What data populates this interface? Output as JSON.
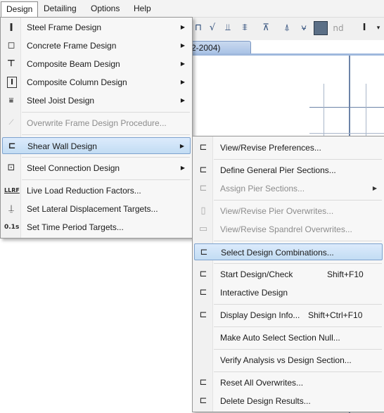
{
  "menubar": {
    "items": [
      "Design",
      "Detailing",
      "Options",
      "Help"
    ]
  },
  "toolbar": {
    "doc_tab": "2-2004)",
    "nd_label": "nd"
  },
  "design_menu": {
    "items": [
      {
        "label": "Steel Frame Design",
        "icon": "steel-frame-icon",
        "submenu": true,
        "enabled": true
      },
      {
        "label": "Concrete Frame Design",
        "icon": "concrete-frame-icon",
        "submenu": true,
        "enabled": true
      },
      {
        "label": "Composite Beam Design",
        "icon": "composite-beam-icon",
        "submenu": true,
        "enabled": true
      },
      {
        "label": "Composite Column Design",
        "icon": "composite-column-icon",
        "submenu": true,
        "enabled": true
      },
      {
        "label": "Steel Joist Design",
        "icon": "steel-joist-icon",
        "submenu": true,
        "enabled": true
      },
      {
        "label": "Overwrite Frame Design Procedure...",
        "icon": "overwrite-procedure-icon",
        "submenu": false,
        "enabled": false
      },
      {
        "label": "Shear Wall Design",
        "icon": "shear-wall-icon",
        "submenu": true,
        "enabled": true,
        "highlighted": true
      },
      {
        "label": "Steel Connection Design",
        "icon": "steel-connection-icon",
        "submenu": true,
        "enabled": true
      },
      {
        "label": "Live Load Reduction Factors...",
        "icon": "llrf-icon",
        "icon_text": "LLRF",
        "submenu": false,
        "enabled": true
      },
      {
        "label": "Set Lateral Displacement Targets...",
        "icon": "displacement-target-icon",
        "submenu": false,
        "enabled": true
      },
      {
        "label": "Set Time Period Targets...",
        "icon": "time-period-icon",
        "icon_text": "0.1s",
        "submenu": false,
        "enabled": true
      }
    ]
  },
  "shear_wall_menu": {
    "items": [
      {
        "label": "View/Revise Preferences...",
        "shortcut": "",
        "icon": "preferences-icon",
        "enabled": true
      },
      {
        "label": "Define General Pier Sections...",
        "shortcut": "",
        "icon": "define-pier-icon",
        "enabled": true
      },
      {
        "label": "Assign Pier Sections...",
        "shortcut": "",
        "icon": "assign-pier-icon",
        "enabled": false,
        "submenu": true
      },
      {
        "label": "View/Revise Pier Overwrites...",
        "shortcut": "",
        "icon": "pier-overwrites-icon",
        "enabled": false
      },
      {
        "label": "View/Revise Spandrel Overwrites...",
        "shortcut": "",
        "icon": "spandrel-overwrites-icon",
        "enabled": false
      },
      {
        "label": "Select Design Combinations...",
        "shortcut": "",
        "icon": "design-combinations-icon",
        "enabled": true,
        "highlighted": true
      },
      {
        "label": "Start Design/Check",
        "shortcut": "Shift+F10",
        "icon": "start-design-icon",
        "enabled": true
      },
      {
        "label": "Interactive Design",
        "shortcut": "",
        "icon": "interactive-design-icon",
        "enabled": true
      },
      {
        "label": "Display Design Info...",
        "shortcut": "Shift+Ctrl+F10",
        "icon": "design-info-icon",
        "enabled": true
      },
      {
        "label": "Make Auto Select Section Null...",
        "shortcut": "",
        "icon": "",
        "enabled": true
      },
      {
        "label": "Verify Analysis vs Design Section...",
        "shortcut": "",
        "icon": "",
        "enabled": true
      },
      {
        "label": "Reset All Overwrites...",
        "shortcut": "",
        "icon": "reset-overwrites-icon",
        "enabled": true
      },
      {
        "label": "Delete Design Results...",
        "shortcut": "",
        "icon": "delete-results-icon",
        "enabled": true
      }
    ]
  },
  "colors": {
    "highlight": "#c2dcf3",
    "highlight_border": "#7da2ce",
    "disabled_text": "#8c8c8c",
    "tab_blue": "#aac3e6"
  }
}
